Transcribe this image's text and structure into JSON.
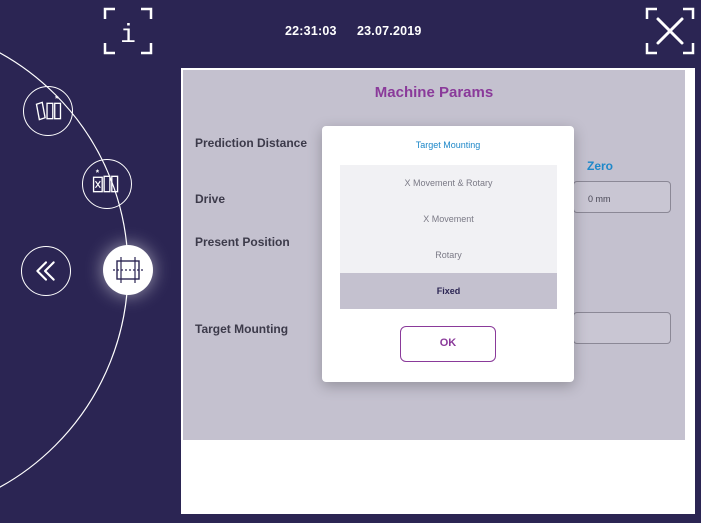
{
  "header": {
    "time": "22:31:03",
    "date": "23.07.2019",
    "info_label": "i"
  },
  "panel": {
    "title": "Machine Params",
    "labels": {
      "prediction_distance": "Prediction Distance",
      "drive": "Drive",
      "present_position": "Present Position",
      "target_mounting": "Target Mounting"
    },
    "zero_label": "Zero",
    "drive_value": "0 mm"
  },
  "modal": {
    "title": "Target Mounting",
    "options": [
      "X Movement & Rotary",
      "X Movement",
      "Rotary",
      "Fixed"
    ],
    "selected": "Fixed",
    "ok_label": "OK"
  },
  "colors": {
    "background": "#2b2553",
    "accent": "#8a3a9a",
    "link": "#1e88c9",
    "panel": "#c4c1cf"
  },
  "icons": {
    "info": "info-icon",
    "close": "close-icon",
    "back": "double-chevron-left-icon",
    "mount_a": "mounting-mode-icon",
    "mount_b": "mounting-mode-icon",
    "active": "machine-params-icon"
  }
}
